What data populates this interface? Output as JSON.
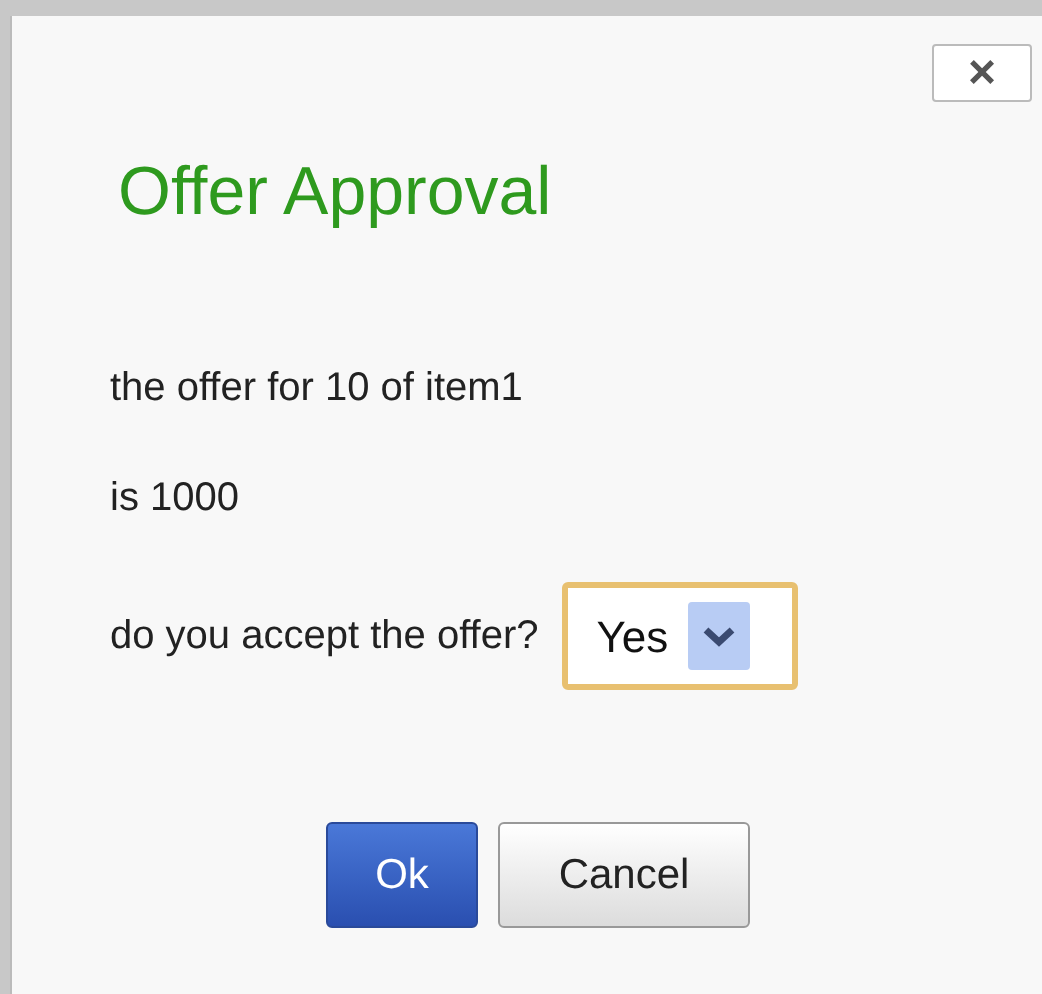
{
  "dialog": {
    "close_label": "×",
    "title": "Offer Approval",
    "lines": [
      "the offer for 10 of item1",
      "is 1000"
    ],
    "question": {
      "label": "do you accept the offer?",
      "value": "Yes"
    },
    "buttons": [
      {
        "label": "Ok",
        "kind": "primary"
      },
      {
        "label": "Cancel",
        "kind": "secondary"
      }
    ]
  }
}
